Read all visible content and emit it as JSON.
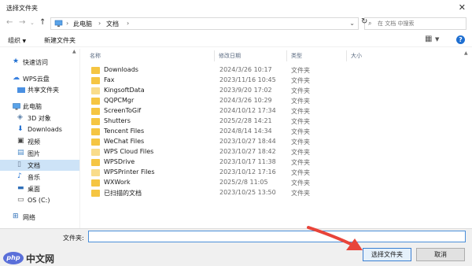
{
  "window": {
    "title": "选择文件夹"
  },
  "address": {
    "segments": [
      "此电脑",
      "文档"
    ]
  },
  "search": {
    "placeholder": "在 文档 中搜索"
  },
  "toolbar": {
    "organize": "组织",
    "new_folder": "新建文件夹"
  },
  "sidebar": {
    "items": [
      {
        "label": "快速访问",
        "icon": "star-icon"
      },
      {
        "label": "WPS云盘",
        "icon": "cloud-icon"
      },
      {
        "label": "共享文件夹",
        "icon": "shared-folder-icon"
      },
      {
        "label": "此电脑",
        "icon": "computer-icon"
      },
      {
        "label": "3D 对象",
        "icon": "cube-icon"
      },
      {
        "label": "Downloads",
        "icon": "download-icon"
      },
      {
        "label": "视频",
        "icon": "video-icon"
      },
      {
        "label": "图片",
        "icon": "picture-icon"
      },
      {
        "label": "文档",
        "icon": "document-icon",
        "selected": true
      },
      {
        "label": "音乐",
        "icon": "music-icon"
      },
      {
        "label": "桌面",
        "icon": "desktop-icon"
      },
      {
        "label": "OS (C:)",
        "icon": "drive-icon"
      },
      {
        "label": "网络",
        "icon": "network-icon"
      }
    ]
  },
  "columns": {
    "name": "名称",
    "modified": "修改日期",
    "type": "类型",
    "size": "大小"
  },
  "files": [
    {
      "name": "Downloads",
      "date": "2024/3/26 10:17",
      "type": "文件夹"
    },
    {
      "name": "Fax",
      "date": "2023/11/16 10:45",
      "type": "文件夹"
    },
    {
      "name": "KingsoftData",
      "date": "2023/9/20 17:02",
      "type": "文件夹"
    },
    {
      "name": "QQPCMgr",
      "date": "2024/3/26 10:29",
      "type": "文件夹"
    },
    {
      "name": "ScreenToGif",
      "date": "2024/10/12 17:34",
      "type": "文件夹"
    },
    {
      "name": "Shutters",
      "date": "2025/2/28 14:21",
      "type": "文件夹"
    },
    {
      "name": "Tencent Files",
      "date": "2024/8/14 14:34",
      "type": "文件夹"
    },
    {
      "name": "WeChat Files",
      "date": "2023/10/27 18:44",
      "type": "文件夹"
    },
    {
      "name": "WPS Cloud Files",
      "date": "2023/10/27 18:42",
      "type": "文件夹"
    },
    {
      "name": "WPSDrive",
      "date": "2023/10/17 11:38",
      "type": "文件夹"
    },
    {
      "name": "WPSPrinter Files",
      "date": "2023/10/12 17:16",
      "type": "文件夹"
    },
    {
      "name": "WXWork",
      "date": "2025/2/8 11:05",
      "type": "文件夹"
    },
    {
      "name": "已扫描的文档",
      "date": "2023/10/25 13:50",
      "type": "文件夹"
    }
  ],
  "footer": {
    "folder_label": "文件夹:",
    "folder_value": "",
    "select_button": "选择文件夹",
    "cancel_button": "取消"
  },
  "watermark": {
    "logo": "php",
    "text": "中文网"
  },
  "colors": {
    "accent": "#1f6fd1",
    "selection": "#cde3f7",
    "folder": "#f5c542",
    "arrow": "#e8443a"
  }
}
